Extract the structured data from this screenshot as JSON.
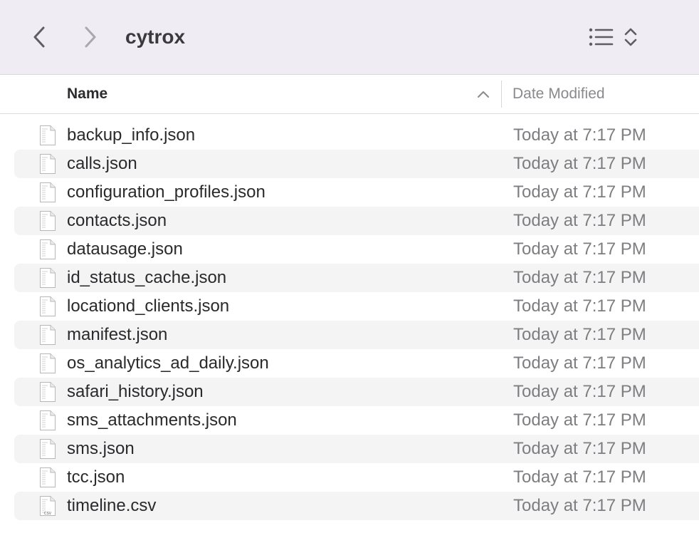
{
  "toolbar": {
    "title": "cytrox",
    "back_icon": "chevron-left-icon",
    "forward_icon": "chevron-right-icon",
    "view_icon": "list-view-icon",
    "sort_icon": "up-down-chevron-icon"
  },
  "columns": {
    "name_label": "Name",
    "date_label": "Date Modified",
    "sort_direction": "ascending"
  },
  "files": [
    {
      "name": "backup_info.json",
      "modified": "Today at 7:17 PM",
      "icon": "json-file-icon"
    },
    {
      "name": "calls.json",
      "modified": "Today at 7:17 PM",
      "icon": "json-file-icon"
    },
    {
      "name": "configuration_profiles.json",
      "modified": "Today at 7:17 PM",
      "icon": "json-file-icon"
    },
    {
      "name": "contacts.json",
      "modified": "Today at 7:17 PM",
      "icon": "json-file-icon"
    },
    {
      "name": "datausage.json",
      "modified": "Today at 7:17 PM",
      "icon": "json-file-icon"
    },
    {
      "name": "id_status_cache.json",
      "modified": "Today at 7:17 PM",
      "icon": "json-file-icon"
    },
    {
      "name": "locationd_clients.json",
      "modified": "Today at 7:17 PM",
      "icon": "json-file-icon"
    },
    {
      "name": "manifest.json",
      "modified": "Today at 7:17 PM",
      "icon": "json-file-icon"
    },
    {
      "name": "os_analytics_ad_daily.json",
      "modified": "Today at 7:17 PM",
      "icon": "json-file-icon"
    },
    {
      "name": "safari_history.json",
      "modified": "Today at 7:17 PM",
      "icon": "json-file-icon"
    },
    {
      "name": "sms_attachments.json",
      "modified": "Today at 7:17 PM",
      "icon": "json-file-icon"
    },
    {
      "name": "sms.json",
      "modified": "Today at 7:17 PM",
      "icon": "json-file-icon"
    },
    {
      "name": "tcc.json",
      "modified": "Today at 7:17 PM",
      "icon": "json-file-icon"
    },
    {
      "name": "timeline.csv",
      "modified": "Today at 7:17 PM",
      "icon": "csv-file-icon",
      "icon_label": "CSV"
    }
  ],
  "colors": {
    "toolbar_bg": "#f0ecf3",
    "row_alt_bg": "#f4f4f5",
    "date_text": "#7e7e82"
  }
}
